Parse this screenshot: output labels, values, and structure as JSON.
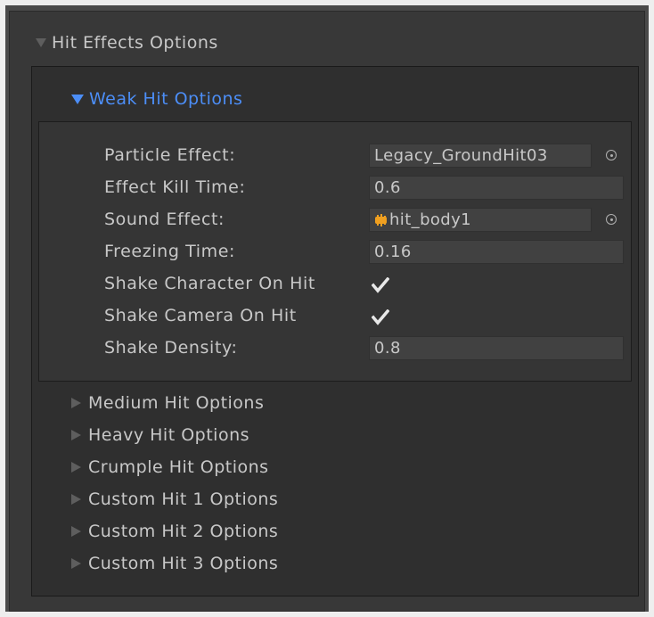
{
  "colors": {
    "accent_blue": "#4c8ef7",
    "text": "#c8c8c8",
    "panel_bg": "#383838",
    "inner_bg": "#2f2f2f",
    "audio_icon_orange": "#f0a020"
  },
  "root_foldout": {
    "label": "Hit Effects Options",
    "expanded": true
  },
  "weak_foldout": {
    "label": "Weak Hit Options",
    "expanded": true
  },
  "fields": {
    "particle_effect": {
      "label": "Particle Effect:",
      "value": "Legacy_GroundHit03"
    },
    "effect_kill_time": {
      "label": "Effect Kill Time:",
      "value": "0.6"
    },
    "sound_effect": {
      "label": "Sound Effect:",
      "value": "hit_body1",
      "icon": "audio-clip-icon"
    },
    "freezing_time": {
      "label": "Freezing Time:",
      "value": "0.16"
    },
    "shake_character": {
      "label": "Shake Character On Hit",
      "checked": true
    },
    "shake_camera": {
      "label": "Shake Camera On Hit",
      "checked": true
    },
    "shake_density": {
      "label": "Shake Density:",
      "value": "0.8"
    }
  },
  "collapsed_foldouts": [
    {
      "label": "Medium Hit Options"
    },
    {
      "label": "Heavy Hit Options"
    },
    {
      "label": "Crumple Hit Options"
    },
    {
      "label": "Custom Hit 1 Options"
    },
    {
      "label": "Custom Hit 2 Options"
    },
    {
      "label": "Custom Hit 3 Options"
    }
  ]
}
